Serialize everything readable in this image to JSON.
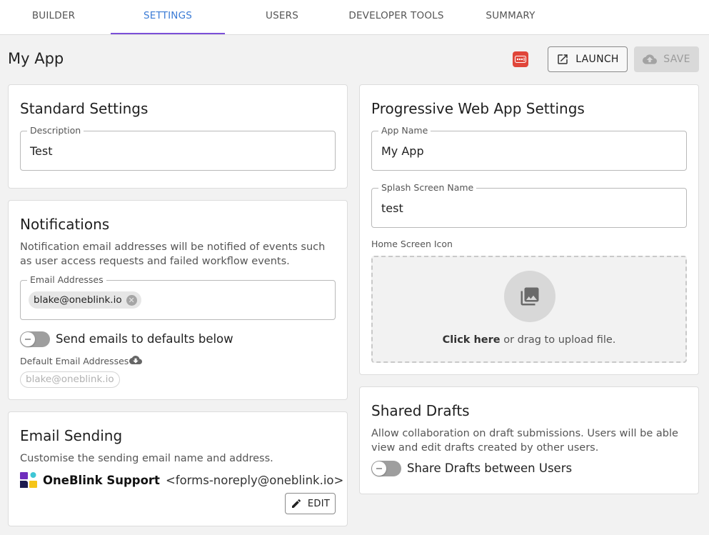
{
  "tabs": [
    {
      "label": "BUILDER"
    },
    {
      "label": "SETTINGS"
    },
    {
      "label": "USERS"
    },
    {
      "label": "DEVELOPER TOOLS"
    },
    {
      "label": "SUMMARY"
    }
  ],
  "active_tab": "SETTINGS",
  "page": {
    "title": "My App"
  },
  "toolbar": {
    "launch_label": "LAUNCH",
    "save_label": "SAVE"
  },
  "standard_settings": {
    "title": "Standard Settings",
    "description_label": "Description",
    "description_value": "Test"
  },
  "notifications": {
    "title": "Notifications",
    "description": "Notification email addresses will be notified of events such as user access requests and failed workflow events.",
    "email_label": "Email Addresses",
    "email_chip": "blake@oneblink.io",
    "toggle_label": "Send emails to defaults below",
    "default_label": "Default Email Addresses",
    "default_chip": "blake@oneblink.io"
  },
  "email_sending": {
    "title": "Email Sending",
    "description": "Customise the sending email name and address.",
    "sender_name": "OneBlink Support",
    "sender_email": "<forms-noreply@oneblink.io>",
    "edit_label": "EDIT"
  },
  "pwa": {
    "title": "Progressive Web App Settings",
    "app_name_label": "App Name",
    "app_name_value": "My App",
    "splash_label": "Splash Screen Name",
    "splash_value": "test",
    "home_icon_label": "Home Screen Icon",
    "upload_link": "Click here",
    "upload_text": " or drag to upload file."
  },
  "shared_drafts": {
    "title": "Shared Drafts",
    "description": "Allow collaboration on draft submissions. Users will be able view and edit drafts created by other users.",
    "toggle_label": "Share Drafts between Users"
  },
  "colors": {
    "tab_active_text": "#3a7bd5",
    "tab_underline": "#7b4fd8",
    "dev_tools_icon": "#e0463a",
    "logo_purple": "#6f2dbd",
    "logo_cyan": "#3ec6d6",
    "logo_yellow": "#f5c518",
    "logo_navy": "#1d1b4f"
  },
  "icons": [
    "open-in-new-icon",
    "cloud-upload-icon",
    "cancel-circle-icon",
    "cloud-download-icon",
    "image-icon",
    "pencil-icon",
    "developer-tools-icon",
    "oneblink-logo"
  ]
}
